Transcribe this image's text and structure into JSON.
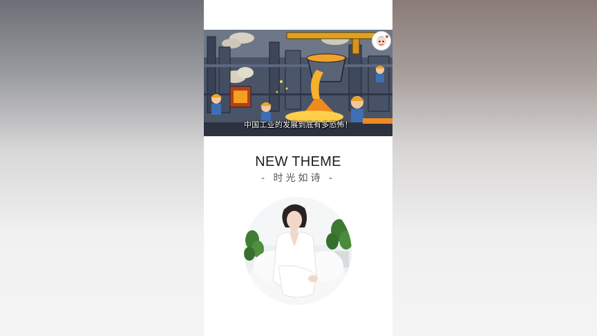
{
  "video": {
    "caption": "中国工业的发展到底有多恐怖！",
    "channel_badge_icon": "cartoon-avatar-icon"
  },
  "theme": {
    "title": "NEW THEME",
    "subtitle": "- 时光如诗 -"
  },
  "colors": {
    "panel_background": "#ffffff",
    "title_text": "#1e1e1e",
    "subtitle_text": "#555555",
    "molten_metal": "#f08a1c"
  }
}
